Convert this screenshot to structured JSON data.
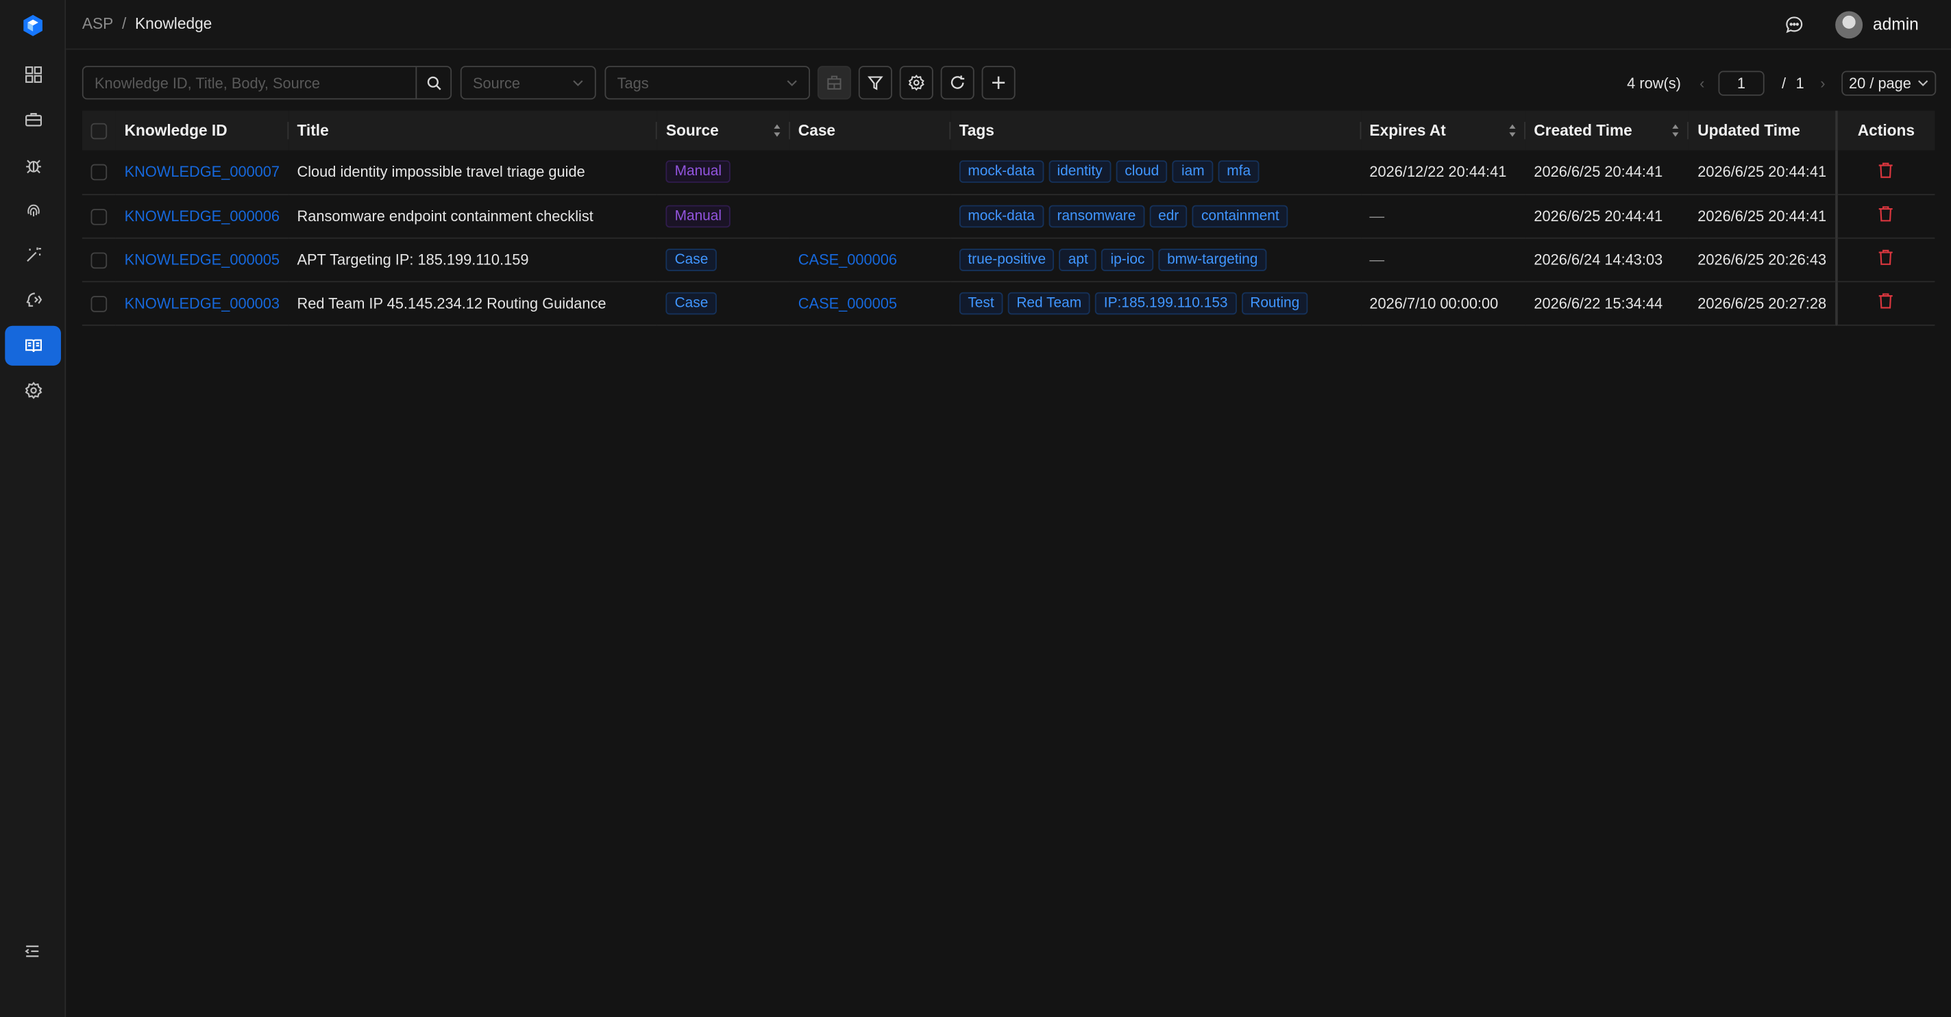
{
  "breadcrumb": {
    "root": "ASP",
    "sep": "/",
    "current": "Knowledge"
  },
  "user": {
    "name": "admin"
  },
  "toolbar": {
    "search_placeholder": "Knowledge ID, Title, Body, Source",
    "source_placeholder": "Source",
    "tags_placeholder": "Tags"
  },
  "pager": {
    "rows": "4 row(s)",
    "page": "1",
    "sep": "/",
    "total": "1",
    "size": "20 / page"
  },
  "columns": [
    "Knowledge ID",
    "Title",
    "Source",
    "Case",
    "Tags",
    "Expires At",
    "Created Time",
    "Updated Time",
    "Actions"
  ],
  "rows": [
    {
      "id": "KNOWLEDGE_000007",
      "title": "Cloud identity impossible travel triage guide",
      "source": "Manual",
      "case": "",
      "tags": [
        "mock-data",
        "identity",
        "cloud",
        "iam",
        "mfa"
      ],
      "expires": "2026/12/22 20:44:41",
      "created": "2026/6/25 20:44:41",
      "updated": "2026/6/25 20:44:41"
    },
    {
      "id": "KNOWLEDGE_000006",
      "title": "Ransomware endpoint containment checklist",
      "source": "Manual",
      "case": "",
      "tags": [
        "mock-data",
        "ransomware",
        "edr",
        "containment"
      ],
      "expires": "—",
      "created": "2026/6/25 20:44:41",
      "updated": "2026/6/25 20:44:41"
    },
    {
      "id": "KNOWLEDGE_000005",
      "title": "APT Targeting IP: 185.199.110.159",
      "source": "Case",
      "case": "CASE_000006",
      "tags": [
        "true-positive",
        "apt",
        "ip-ioc",
        "bmw-targeting"
      ],
      "expires": "—",
      "created": "2026/6/24 14:43:03",
      "updated": "2026/6/25 20:26:43"
    },
    {
      "id": "KNOWLEDGE_000003",
      "title": "Red Team IP 45.145.234.12 Routing Guidance",
      "source": "Case",
      "case": "CASE_000005",
      "tags": [
        "Test",
        "Red Team",
        "IP:185.199.110.153",
        "Routing"
      ],
      "expires": "2026/7/10 00:00:00",
      "created": "2026/6/22 15:34:44",
      "updated": "2026/6/25 20:27:28"
    }
  ],
  "colors": {
    "accent": "#1668dc",
    "danger": "#d9363e",
    "manual": "#9254de",
    "tag_blue": "#4096ff"
  }
}
